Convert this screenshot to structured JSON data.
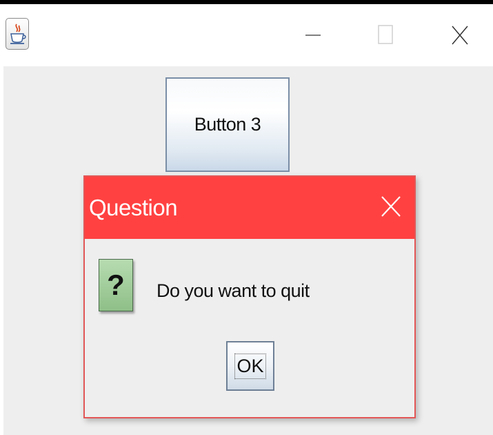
{
  "window": {
    "icon": "java-coffee-cup-icon",
    "controls": [
      "minimize-icon",
      "maximize-icon",
      "close-icon"
    ]
  },
  "main": {
    "button_label": "Button 3"
  },
  "dialog": {
    "title": "Question",
    "title_bar_color": "#ff4141",
    "icon": "question-icon",
    "icon_glyph": "?",
    "message": "Do you want to quit",
    "ok_label": "OK",
    "close_icon": "close-icon"
  }
}
